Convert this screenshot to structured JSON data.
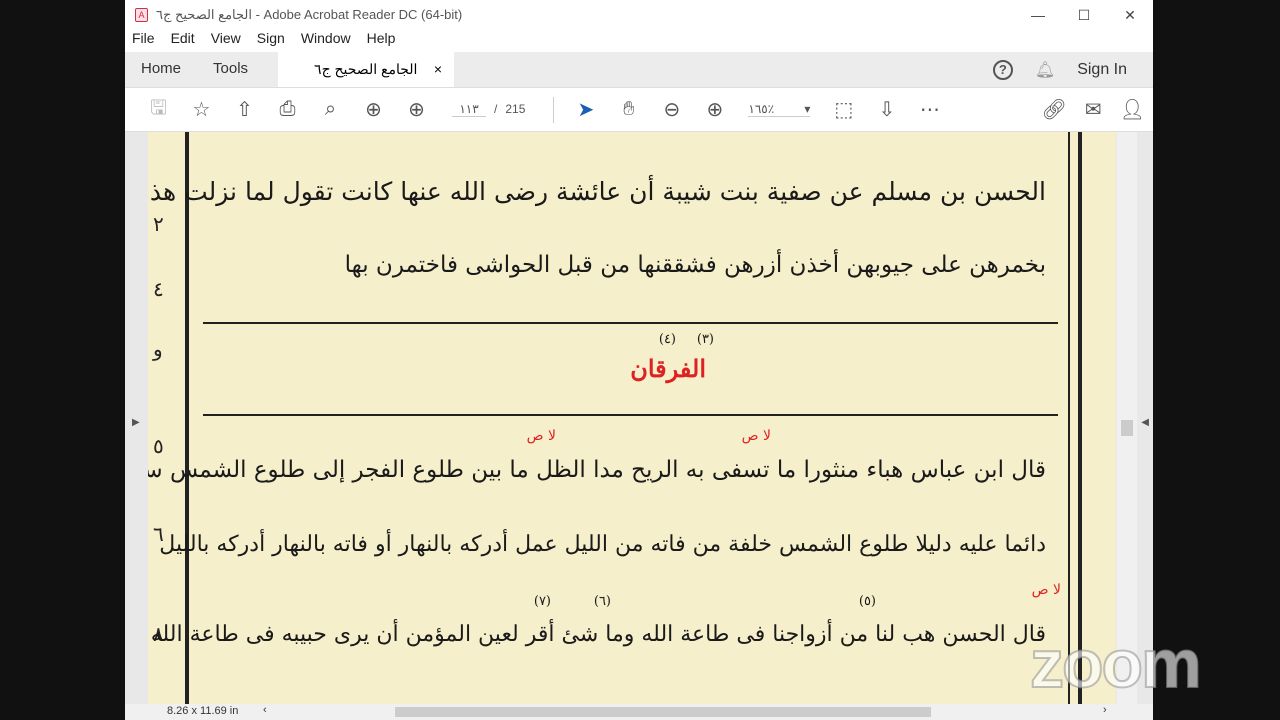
{
  "window": {
    "title": "الجامع الصحيح ج٦ - Adobe Acrobat Reader DC (64-bit)",
    "minimize": "—",
    "maximize": "☐",
    "close": "✕"
  },
  "menu": [
    "File",
    "Edit",
    "View",
    "Sign",
    "Window",
    "Help"
  ],
  "tabs": {
    "home": "Home",
    "tools": "Tools",
    "document": "الجامع الصحيح ج٦",
    "close": "×",
    "help": "?",
    "sign_in": "Sign In"
  },
  "toolbar": {
    "current_page": "١١٣",
    "page_sep": "/",
    "total_pages": "215",
    "zoom": "١٦٥٪"
  },
  "document": {
    "lines": [
      "الحسن بن مسلم عن صفية بنت شيبة أن عائشة رضى الله عنها كانت تقول لما نزلت هذه الآية وليضربن",
      "بخمرهن على جيوبهن أخذن أزرهن فشققنها من قبل الحواشى فاختمرن بها",
      "قال ابن عباس هباء منثورا ما تسفى به الريح مدا الظل ما بين طلوع الفجر إلى طلوع الشمس ساكنا",
      "دائما عليه دليلا طلوع الشمس خلفة من فاته من الليل عمل أدركه بالنهار أو فاته بالنهار أدركه بالليل",
      "قال الحسن هب لنا من أزواجنا فى طاعة الله وما شئ أقر لعين المؤمن أن يرى حبيبه فى طاعة الله وقال"
    ],
    "heading": "الفرقان",
    "heading_notes": [
      "(٤)",
      "(٣)"
    ],
    "notes": [
      "(٧)",
      "(٦)",
      "(٥)"
    ],
    "red_marks": [
      "لا ص",
      "لا ص",
      "لا ص"
    ],
    "margin_numbers": [
      "٢",
      "٤",
      "و",
      "٥",
      "٦",
      "٨"
    ]
  },
  "status": {
    "page_size": "8.26 x 11.69 in"
  },
  "watermark": "zoom"
}
